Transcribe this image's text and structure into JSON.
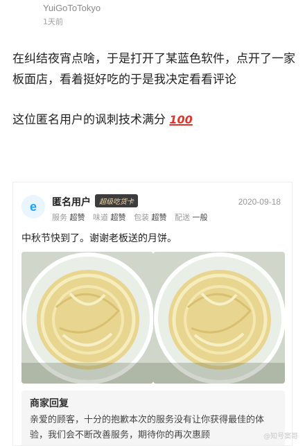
{
  "post": {
    "username": "YuiGoToTokyo",
    "time": "1天前",
    "text": "在纠结夜宵点啥，于是打开了某蓝色软件，点开了一家板面店，看着挺好吃的于是我决定看看评论",
    "text2": "这位匿名用户的讽刺技术满分",
    "emoji": "100"
  },
  "review": {
    "avatar_letter": "e",
    "user": "匿名用户",
    "badge": "超级吃货卡",
    "date": "2020-09-18",
    "ratings": [
      {
        "label": "服务",
        "value": "超赞"
      },
      {
        "label": "味道",
        "value": "超赞"
      },
      {
        "label": "包装",
        "value": "超赞"
      },
      {
        "label": "配送",
        "value": "一般"
      }
    ],
    "text": "中秋节快到了。谢谢老板送的月饼。"
  },
  "reply": {
    "title": "商家回复",
    "body": "亲爱的顾客，十分的抱歉本次的服务没有让你获得最佳的体验，我们会不断改善服务，期待你的再次惠顾"
  },
  "watermark": "@知号窦哥"
}
